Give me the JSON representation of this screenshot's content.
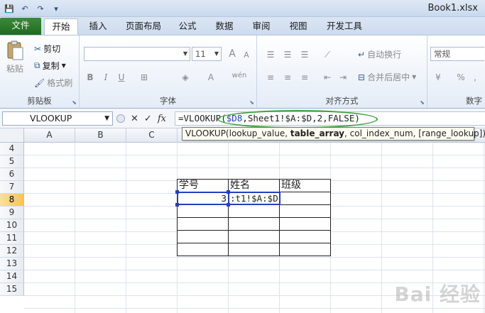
{
  "window": {
    "title": "Book1.xlsx"
  },
  "qat": {
    "save": "💾",
    "undo": "↶",
    "redo": "↷",
    "customize": "▾"
  },
  "tabs": [
    "文件",
    "开始",
    "插入",
    "页面布局",
    "公式",
    "数据",
    "审阅",
    "视图",
    "开发工具"
  ],
  "ribbon": {
    "clipboard": {
      "label": "剪贴板",
      "paste": "粘贴",
      "cut": "剪切",
      "copy": "复制",
      "format_painter": "格式刷"
    },
    "font": {
      "label": "字体",
      "font_name": "",
      "font_size": "11",
      "grow": "A",
      "shrink": "A",
      "bold": "B",
      "italic": "I",
      "underline": "U",
      "wen": "wén"
    },
    "alignment": {
      "label": "对齐方式",
      "wrap": "自动换行",
      "merge": "合并后居中"
    },
    "number": {
      "label": "数字",
      "format": "常规",
      "percent": "%",
      "comma": ","
    }
  },
  "formula_bar": {
    "name_box": "VLOOKUP",
    "fx": "fx",
    "formula_prefix": "=VLOOKUP(",
    "formula_ref1": "$D8",
    "formula_rest": ",Sheet1!$A:$D,2,FALSE)"
  },
  "tooltip": {
    "start": "VLOOKUP(lookup_value, ",
    "bold": "table_array",
    "end": ", col_index_num, [range_lookup])"
  },
  "columns": [
    "A",
    "B",
    "C"
  ],
  "rows": [
    "4",
    "5",
    "6",
    "7",
    "8",
    "9",
    "10",
    "11",
    "12",
    "13",
    "14",
    "15"
  ],
  "table": {
    "headers": [
      "学号",
      "姓名",
      "班级"
    ],
    "edit_left": "3",
    "edit_right": ":t1!$A:$D"
  },
  "watermark": "Bai 经验"
}
